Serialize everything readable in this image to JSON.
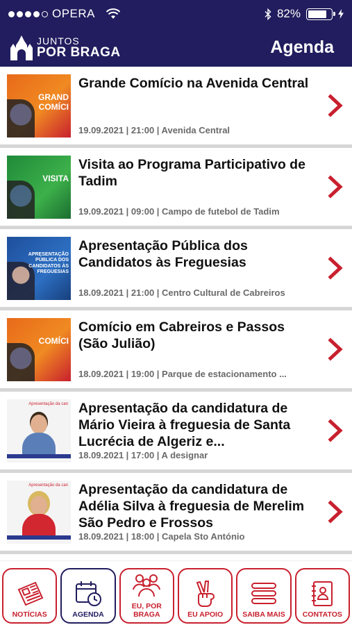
{
  "status": {
    "carrier": "OPERA",
    "battery": "82%",
    "battery_level": 0.82
  },
  "header": {
    "logo_top": "JUNTOS",
    "logo_bottom": "POR BRAGA",
    "title": "Agenda"
  },
  "events": [
    {
      "title": "Grande Comício na Avenida Central",
      "meta": "19.09.2021 | 21:00 | Avenida Central",
      "thumb_text": "GRAND\nCOMÍCI",
      "thumb_style": "orange"
    },
    {
      "title": "Visita ao Programa Participativo de Tadim",
      "meta": "19.09.2021 | 09:00 | Campo de futebol de Tadim",
      "thumb_text": "VISITA",
      "thumb_style": "green"
    },
    {
      "title": "Apresentação Pública dos Candidatos às Freguesias",
      "meta": "18.09.2021 | 21:00 | Centro Cultural de Cabreiros",
      "thumb_text": "APRESENTAÇÃO\nPÚBLICA DOS\nCANDIDATOS ÀS\nFREGUESIAS",
      "thumb_style": "blue"
    },
    {
      "title": "Comício em Cabreiros e Passos (São Julião)",
      "meta": "18.09.2021 | 19:00 | Parque de estacionamento ...",
      "thumb_text": "COMÍCI",
      "thumb_style": "orange"
    },
    {
      "title": "Apresentação da candidatura de Mário Vieira à freguesia de Santa Lucrécia de Algeriz e...",
      "meta": "18.09.2021 | 17:00 | A designar",
      "thumb_text": "Apresentação da can",
      "thumb_style": "portrait-man"
    },
    {
      "title": "Apresentação da candidatura de Adélia Silva à freguesia de Merelim São Pedro e Frossos",
      "meta": "18.09.2021 | 18:00 | Capela Sto António",
      "thumb_text": "Apresentação da can",
      "thumb_style": "portrait-woman"
    }
  ],
  "tabs": [
    {
      "label": "NOTÍCIAS",
      "icon": "newspaper-icon",
      "active": false
    },
    {
      "label": "AGENDA",
      "icon": "calendar-clock-icon",
      "active": true
    },
    {
      "label": "EU, POR BRAGA",
      "icon": "people-group-icon",
      "active": false
    },
    {
      "label": "EU APOIO",
      "icon": "peace-hand-icon",
      "active": false
    },
    {
      "label": "SAIBA MAIS",
      "icon": "menu-lines-icon",
      "active": false
    },
    {
      "label": "CONTATOS",
      "icon": "contact-card-icon",
      "active": false
    }
  ],
  "colors": {
    "header_bg": "#211d5e",
    "accent_red": "#c8202e",
    "meta_gray": "#6a6a6a"
  }
}
